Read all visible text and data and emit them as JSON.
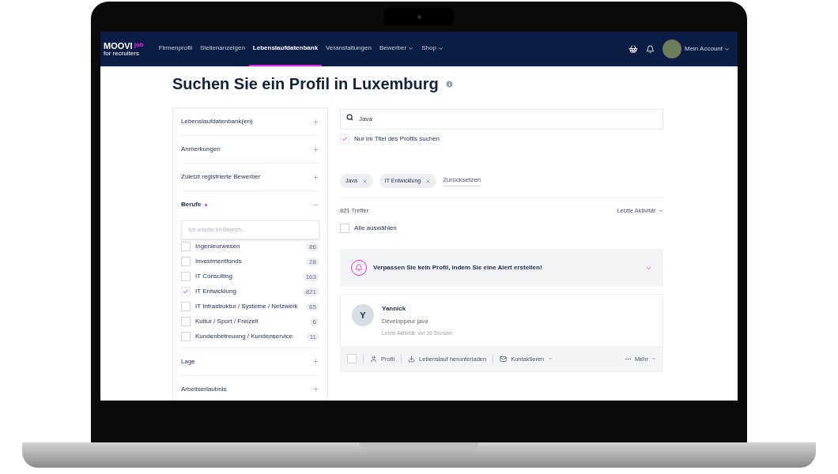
{
  "nav": {
    "logo": {
      "main": "MOOVI",
      "badge": "job",
      "sub": "for recruiters"
    },
    "items": [
      {
        "label": "Firmenprofil",
        "selected": false,
        "dropdown": false
      },
      {
        "label": "Stellenanzeigen",
        "selected": false,
        "dropdown": false
      },
      {
        "label": "Lebenslaufdatenbank",
        "selected": true,
        "dropdown": false
      },
      {
        "label": "Veranstaltungen",
        "selected": false,
        "dropdown": false
      },
      {
        "label": "Bewerber",
        "selected": false,
        "dropdown": true
      },
      {
        "label": "Shop",
        "selected": false,
        "dropdown": true
      }
    ],
    "account": {
      "label": "Mein Account"
    }
  },
  "title": "Suchen Sie ein Profil in Luxemburg",
  "filters": [
    {
      "label": "Lebenslaufdatenbank(en)",
      "expanded": false,
      "marked": false
    },
    {
      "label": "Anmerkungen",
      "expanded": false,
      "marked": false
    },
    {
      "label": "Zuletzt registrierte Bewerber",
      "expanded": false,
      "marked": false
    },
    {
      "label": "Berufe",
      "expanded": true,
      "marked": true,
      "placeholder": "Ich arbeite im Bereich...",
      "options": [
        {
          "label": "Ingenieurwesen",
          "count": "86",
          "checked": false
        },
        {
          "label": "Investmentfonds",
          "count": "28",
          "checked": false
        },
        {
          "label": "IT Consulting",
          "count": "163",
          "checked": false
        },
        {
          "label": "IT Entwicklung",
          "count": "821",
          "checked": true
        },
        {
          "label": "IT Infrastruktur / Systeme / Netzwerk",
          "count": "65",
          "checked": false
        },
        {
          "label": "Kultur / Sport / Freizeit",
          "count": "6",
          "checked": false
        },
        {
          "label": "Kundenbetreuung / Kundenservice",
          "count": "11",
          "checked": false
        }
      ]
    },
    {
      "label": "Lage",
      "expanded": false,
      "marked": false
    },
    {
      "label": "Arbeitserlaubnis",
      "expanded": false,
      "marked": false
    }
  ],
  "search": {
    "value": "Java"
  },
  "title_only": {
    "label": "Nur im Titel des Profils suchen",
    "checked": true
  },
  "chips": [
    "Java",
    "IT Entwicklung"
  ],
  "reset": "Zurücksetzen",
  "results": {
    "count": "821 Treffer",
    "sort": "Letzte Aktivität",
    "select_all": {
      "label": "Alle auswählen",
      "checked": false
    }
  },
  "alert": "Verpassen Sie kein Profil, indem Sie eine Alert erstellen!",
  "candidates": [
    {
      "initial": "Y",
      "name": "Yannick",
      "headline": "Développeur java",
      "activity": "Letzte Aktivität: vor 16 Stunden",
      "checked": false,
      "actions": [
        {
          "kind": "profile",
          "label": "Profil"
        },
        {
          "kind": "download",
          "label": "Lebenslauf herunterladen"
        },
        {
          "kind": "contact",
          "label": "Kontaktieren"
        }
      ],
      "more": "Mehr"
    }
  ]
}
